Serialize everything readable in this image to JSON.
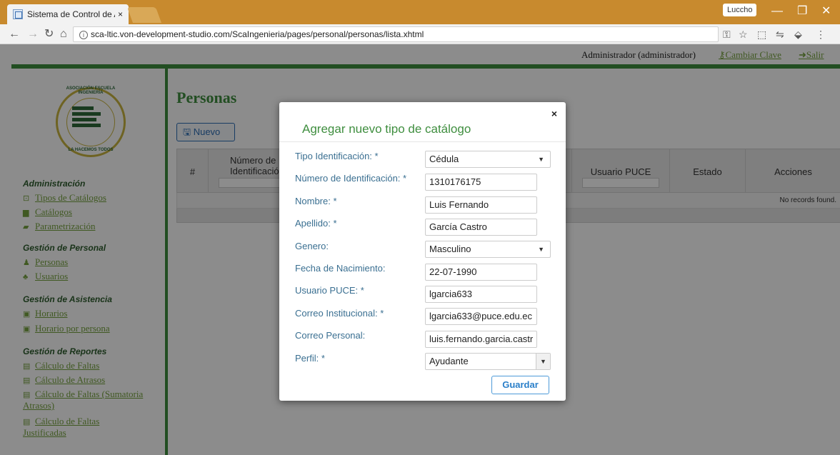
{
  "browser": {
    "tab_title": "Sistema de Control de A",
    "tab_close": "×",
    "profile_name": "Luccho",
    "url": "sca-ltic.von-development-studio.com/ScaIngenieria/pages/personal/personas/lista.xhtml",
    "window_controls": {
      "minimize": "—",
      "maximize": "❐",
      "close": "✕"
    }
  },
  "header": {
    "user": "Administrador (administrador)",
    "change_password": "Cambiar Clave",
    "logout": "Salir"
  },
  "sidebar": {
    "logo_top_text": "ASOCIACIÓN ESCUELA INGENIERÍA",
    "logo_bottom_text": "LA HACEMOS TODOS",
    "sections": [
      {
        "title": "Administración",
        "items": [
          "Tipos de Catálogos",
          "Catálogos",
          "Parametrización"
        ]
      },
      {
        "title": "Gestión de Personal",
        "items": [
          "Personas",
          "Usuarios"
        ]
      },
      {
        "title": "Gestión de Asistencia",
        "items": [
          "Horarios",
          "Horario por persona"
        ]
      },
      {
        "title": "Gestión de Reportes",
        "items": [
          "Cálculo de Faltas",
          "Cálculo de Atrasos",
          "Cálculo de Faltas (Sumatoria",
          "Atrasos)",
          "Cálculo de Faltas",
          "Justificadas"
        ]
      }
    ]
  },
  "main": {
    "title": "Personas",
    "new_button": "Nuevo",
    "table": {
      "columns": [
        "#",
        "Número de Identificació",
        "Usuario PUCE",
        "Estado",
        "Acciones"
      ],
      "empty_message": "No records found."
    }
  },
  "dialog": {
    "title": "Agregar nuevo tipo de catálogo",
    "close": "×",
    "fields": [
      {
        "label": "Tipo Identificación:",
        "required": "*",
        "value": "Cédula",
        "type": "select"
      },
      {
        "label": "Número de Identificación:",
        "required": "*",
        "value": "1310176175",
        "type": "input"
      },
      {
        "label": "Nombre:",
        "required": "*",
        "value": "Luis Fernando",
        "type": "input"
      },
      {
        "label": "Apellido:",
        "required": "*",
        "value": "García Castro",
        "type": "input"
      },
      {
        "label": "Genero:",
        "required": "",
        "value": "Masculino",
        "type": "select"
      },
      {
        "label": "Fecha de Nacimiento:",
        "required": "",
        "value": "22-07-1990",
        "type": "input"
      },
      {
        "label": "Usuario PUCE:",
        "required": "*",
        "value": "lgarcia633",
        "type": "input"
      },
      {
        "label": "Correo Institucional:",
        "required": "*",
        "value": "lgarcia633@puce.edu.ec",
        "type": "input"
      },
      {
        "label": "Correo Personal:",
        "required": "",
        "value": "luis.fernando.garcia.castr",
        "type": "input"
      },
      {
        "label": "Perfil:",
        "required": "*",
        "value": "Ayudante",
        "type": "select"
      }
    ],
    "save_button": "Guardar"
  },
  "colors": {
    "accent_green": "#3f8e3f",
    "link_green": "#76a23f",
    "label_blue": "#3a6f91",
    "button_blue": "#2a7fc9"
  }
}
